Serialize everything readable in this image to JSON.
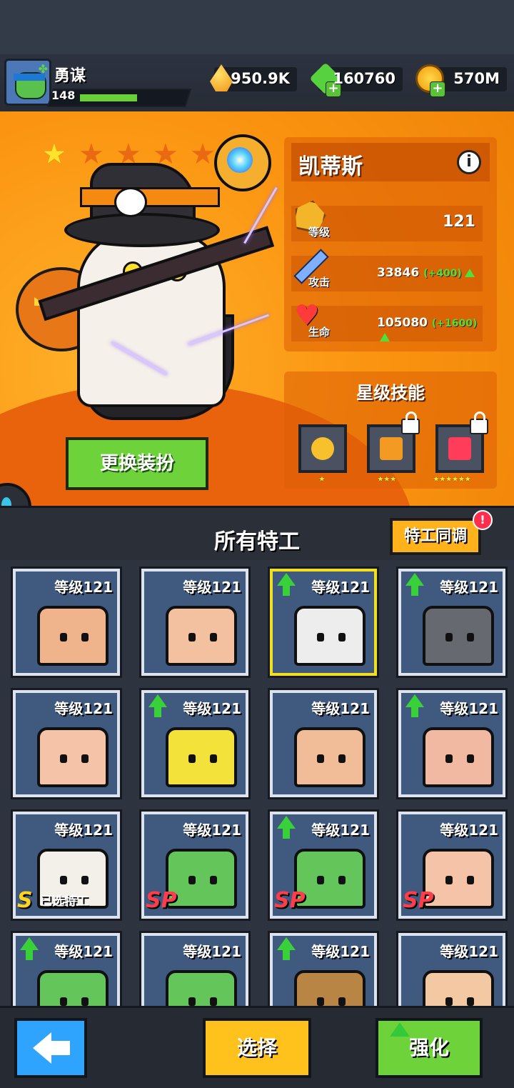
{
  "player": {
    "name": "勇谋",
    "level": "148",
    "xp_progress": 0.6
  },
  "resources": [
    {
      "icon": "drop-icon",
      "value": "950.9K"
    },
    {
      "icon": "gem-icon",
      "value": "160760"
    },
    {
      "icon": "coin-icon",
      "value": "570M"
    }
  ],
  "hero": {
    "name": "凯蒂斯",
    "stars_on": 1,
    "stars_total": 5,
    "level_label": "等级",
    "level_value": "121",
    "attack_label": "攻击",
    "attack_value": "33846",
    "attack_bonus": "(+400)",
    "hp_label": "生命",
    "hp_value": "105080",
    "hp_bonus": "(+1600)",
    "skills_title": "星级技能",
    "skills": [
      {
        "icon": "cat-plus-icon",
        "stars": "★",
        "locked": false
      },
      {
        "icon": "molecule-icon",
        "stars": "★★★",
        "locked": true
      },
      {
        "icon": "health-plus-icon",
        "stars": "★★★★★★",
        "locked": true
      }
    ],
    "change_outfit": "更换装扮"
  },
  "roster": {
    "title": "所有特工",
    "sync_button": "特工同调",
    "sync_alert": "!",
    "level_prefix": "等级121",
    "selected_label": "已选特工",
    "cards": [
      {
        "name": "goggles-agent",
        "color": "#f0b48c",
        "up": false,
        "badge": ""
      },
      {
        "name": "red-scarf-agent",
        "color": "#f3c0a0",
        "up": false,
        "badge": ""
      },
      {
        "name": "cat-agent",
        "color": "#ededed",
        "up": true,
        "badge": "",
        "selected": true
      },
      {
        "name": "gasmask-agent",
        "color": "#666a70",
        "up": true,
        "badge": ""
      },
      {
        "name": "orange-hair-agent",
        "color": "#f4c3a8",
        "up": false,
        "badge": ""
      },
      {
        "name": "sponge-agent",
        "color": "#f2e23a",
        "up": true,
        "badge": ""
      },
      {
        "name": "beard-agent",
        "color": "#f0bd98",
        "up": false,
        "badge": ""
      },
      {
        "name": "pink-hair-agent",
        "color": "#f2b9a2",
        "up": true,
        "badge": ""
      },
      {
        "name": "panda-agent",
        "color": "#f3f0ea",
        "up": false,
        "badge": "S"
      },
      {
        "name": "turtle-blue-agent",
        "color": "#63c55a",
        "up": false,
        "badge": "SP"
      },
      {
        "name": "turtle-red-agent",
        "color": "#63c55a",
        "up": true,
        "badge": "SP"
      },
      {
        "name": "reporter-agent",
        "color": "#f4c3a8",
        "up": false,
        "badge": "SP"
      },
      {
        "name": "turtle-purple-agent",
        "color": "#63c55a",
        "up": true,
        "badge": ""
      },
      {
        "name": "turtle-orange-agent",
        "color": "#63c55a",
        "up": false,
        "badge": ""
      },
      {
        "name": "rat-agent",
        "color": "#b98545",
        "up": true,
        "badge": ""
      },
      {
        "name": "blonde-agent",
        "color": "#f3c9a4",
        "up": false,
        "badge": ""
      }
    ]
  },
  "bottom": {
    "back": "back-arrow-icon",
    "select": "选择",
    "upgrade": "强化"
  },
  "colors": {
    "accent_orange": "#fb9410",
    "green": "#6ed33a",
    "yellow": "#ffc21c",
    "blue": "#2fa4ff"
  }
}
